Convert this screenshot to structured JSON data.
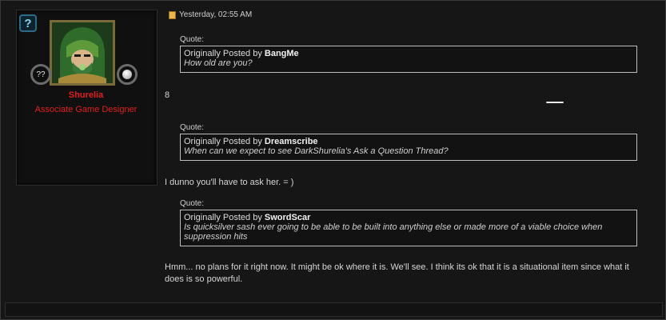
{
  "post": {
    "date": "Yesterday, 02:55 AM"
  },
  "user": {
    "name": "Shurelia",
    "title": "Associate Game Designer",
    "help_badge": "?",
    "level_orb": "??"
  },
  "quotes": [
    {
      "label": "Quote:",
      "prefix": "Originally Posted by ",
      "author": "BangMe",
      "message": "How old are you?"
    },
    {
      "label": "Quote:",
      "prefix": "Originally Posted by ",
      "author": "Dreamscribe",
      "message": "When can we expect to see DarkShurelia's Ask a Question Thread?"
    },
    {
      "label": "Quote:",
      "prefix": "Originally Posted by ",
      "author": "SwordScar",
      "message": "Is quicksilver sash ever going to be able to be built into anything else or made more of a viable choice when suppression hits"
    }
  ],
  "replies": [
    "8",
    "I dunno you'll have to ask her. = )",
    "Hmm... no plans for it right now. It might be ok where it is. We'll see. I think its ok that it is a situational item since what it does is so powerful."
  ],
  "icons": {
    "help": "help-icon",
    "post": "post-icon",
    "orb": "orb-icon"
  },
  "colors": {
    "username": "#e02020",
    "background": "#141414",
    "quote_border": "#bdbdbd",
    "help_badge": "#2f6b86"
  }
}
